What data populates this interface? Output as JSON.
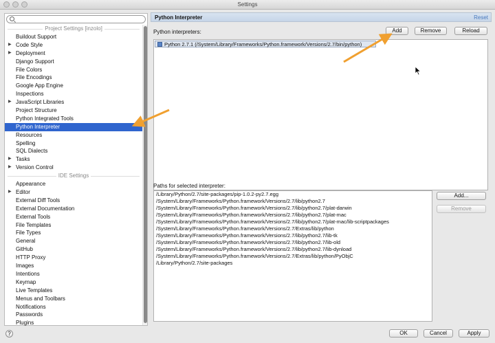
{
  "window": {
    "title": "Settings"
  },
  "search": {
    "placeholder": "",
    "value": ""
  },
  "sections": {
    "project_header": "Project Settings [inzolo]",
    "ide_header": "IDE Settings"
  },
  "project_items": [
    {
      "label": "Buildout Support",
      "expandable": false,
      "selected": false
    },
    {
      "label": "Code Style",
      "expandable": true,
      "selected": false
    },
    {
      "label": "Deployment",
      "expandable": true,
      "selected": false
    },
    {
      "label": "Django Support",
      "expandable": false,
      "selected": false
    },
    {
      "label": "File Colors",
      "expandable": false,
      "selected": false
    },
    {
      "label": "File Encodings",
      "expandable": false,
      "selected": false
    },
    {
      "label": "Google App Engine",
      "expandable": false,
      "selected": false
    },
    {
      "label": "Inspections",
      "expandable": false,
      "selected": false
    },
    {
      "label": "JavaScript Libraries",
      "expandable": true,
      "selected": false
    },
    {
      "label": "Project Structure",
      "expandable": false,
      "selected": false
    },
    {
      "label": "Python Integrated Tools",
      "expandable": false,
      "selected": false
    },
    {
      "label": "Python Interpreter",
      "expandable": false,
      "selected": true
    },
    {
      "label": "Resources",
      "expandable": false,
      "selected": false
    },
    {
      "label": "Spelling",
      "expandable": false,
      "selected": false
    },
    {
      "label": "SQL Dialects",
      "expandable": false,
      "selected": false
    },
    {
      "label": "Tasks",
      "expandable": true,
      "selected": false
    },
    {
      "label": "Version Control",
      "expandable": true,
      "selected": false
    }
  ],
  "ide_items": [
    {
      "label": "Appearance",
      "expandable": false
    },
    {
      "label": "Editor",
      "expandable": true
    },
    {
      "label": "External Diff Tools",
      "expandable": false
    },
    {
      "label": "External Documentation",
      "expandable": false
    },
    {
      "label": "External Tools",
      "expandable": false
    },
    {
      "label": "File Templates",
      "expandable": false
    },
    {
      "label": "File Types",
      "expandable": false
    },
    {
      "label": "General",
      "expandable": false
    },
    {
      "label": "GitHub",
      "expandable": false
    },
    {
      "label": "HTTP Proxy",
      "expandable": false
    },
    {
      "label": "Images",
      "expandable": false
    },
    {
      "label": "Intentions",
      "expandable": false
    },
    {
      "label": "Keymap",
      "expandable": false
    },
    {
      "label": "Live Templates",
      "expandable": false
    },
    {
      "label": "Menus and Toolbars",
      "expandable": false
    },
    {
      "label": "Notifications",
      "expandable": false
    },
    {
      "label": "Passwords",
      "expandable": false
    },
    {
      "label": "Plugins",
      "expandable": false
    }
  ],
  "panel": {
    "title": "Python Interpreter",
    "reset": "Reset",
    "interpreters_label": "Python interpreters:",
    "add": "Add",
    "remove": "Remove",
    "reload": "Reload",
    "interpreters": [
      "Python 2.7.1 (/System/Library/Frameworks/Python.framework/Versions/2.7/bin/python)"
    ],
    "paths_label": "Paths for selected interpreter:",
    "paths_add": "Add...",
    "paths_remove": "Remove",
    "paths": [
      "/Library/Python/2.7/site-packages/pip-1.0.2-py2.7.egg",
      "/System/Library/Frameworks/Python.framework/Versions/2.7/lib/python2.7",
      "/System/Library/Frameworks/Python.framework/Versions/2.7/lib/python2.7/plat-darwin",
      "/System/Library/Frameworks/Python.framework/Versions/2.7/lib/python2.7/plat-mac",
      "/System/Library/Frameworks/Python.framework/Versions/2.7/lib/python2.7/plat-mac/lib-scriptpackages",
      "/System/Library/Frameworks/Python.framework/Versions/2.7/Extras/lib/python",
      "/System/Library/Frameworks/Python.framework/Versions/2.7/lib/python2.7/lib-tk",
      "/System/Library/Frameworks/Python.framework/Versions/2.7/lib/python2.7/lib-old",
      "/System/Library/Frameworks/Python.framework/Versions/2.7/lib/python2.7/lib-dynload",
      "/System/Library/Frameworks/Python.framework/Versions/2.7/Extras/lib/python/PyObjC",
      "/Library/Python/2.7/site-packages"
    ]
  },
  "footer": {
    "help": "?",
    "ok": "OK",
    "cancel": "Cancel",
    "apply": "Apply"
  },
  "colors": {
    "selection": "#2f65ce",
    "annotation_arrow": "#f0a030",
    "header": "#c6d5e8"
  }
}
